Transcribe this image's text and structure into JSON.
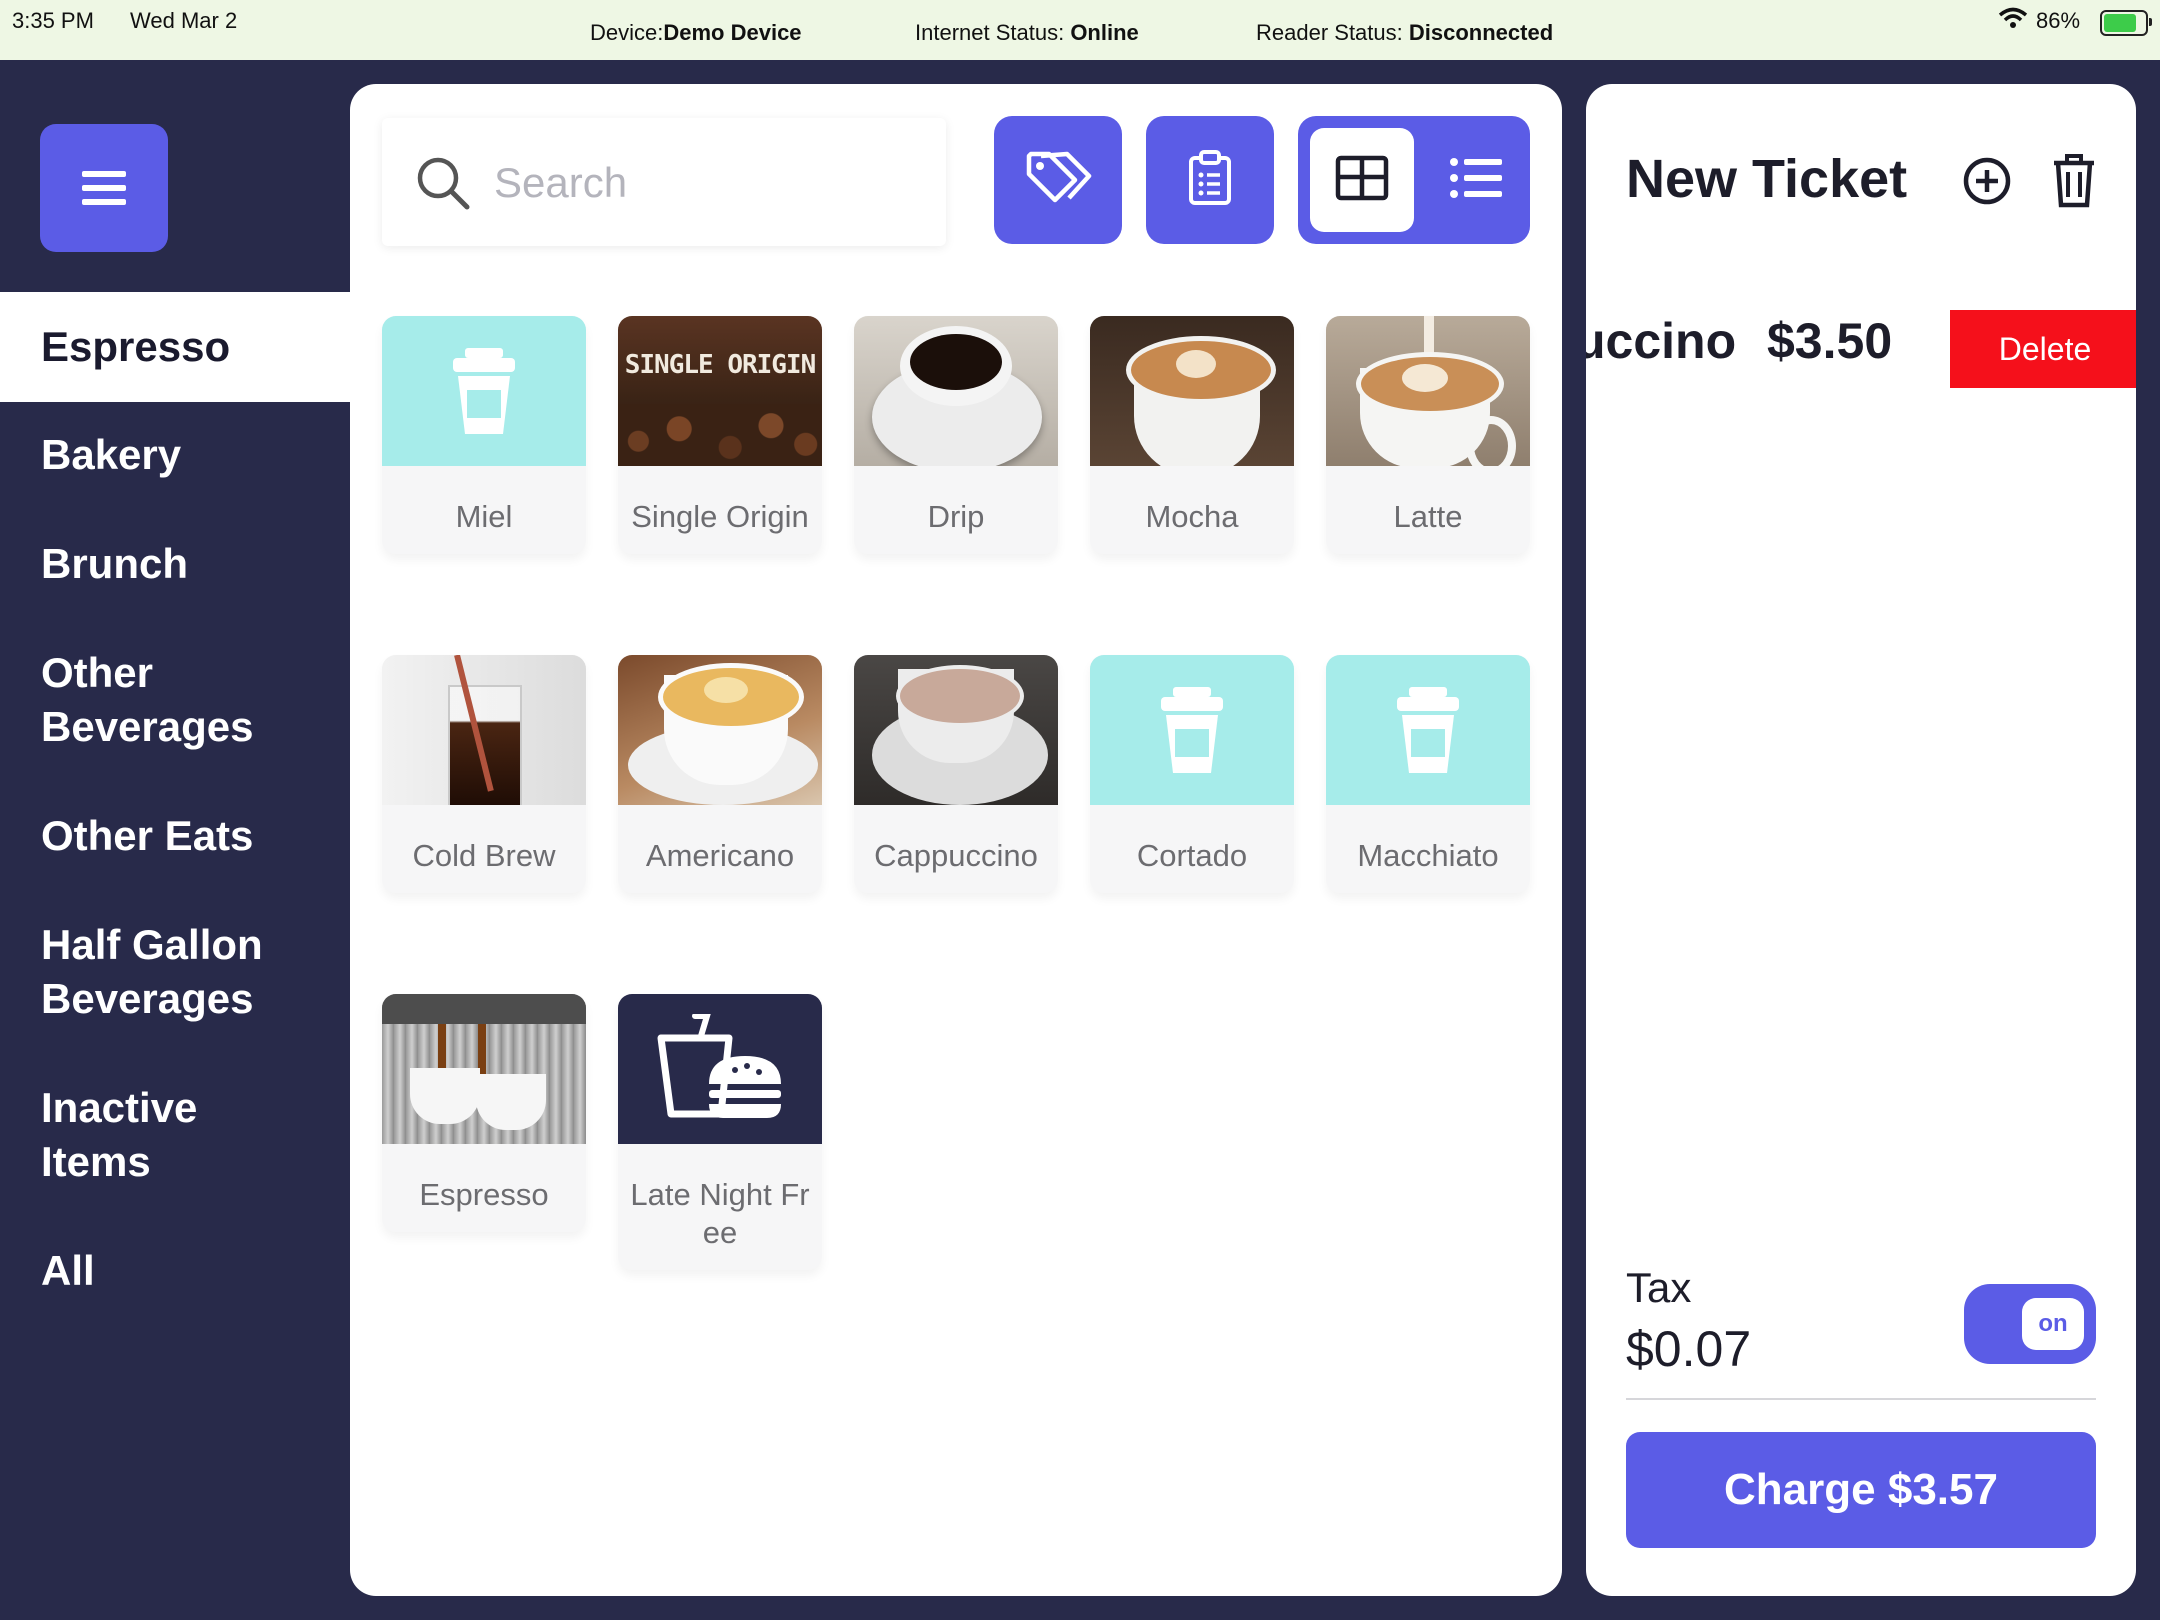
{
  "status_bar": {
    "time": "3:35 PM",
    "date": "Wed Mar 2",
    "device_label": "Device:",
    "device_value": "Demo Device",
    "internet_label": "Internet Status: ",
    "internet_value": "Online",
    "reader_label": "Reader Status: ",
    "reader_value": "Disconnected",
    "battery": "86%"
  },
  "sidebar": {
    "menu_icon": "hamburger-icon",
    "categories": [
      {
        "label": "Espresso",
        "active": true
      },
      {
        "label": "Bakery"
      },
      {
        "label": "Brunch"
      },
      {
        "label": "Other Beverages"
      },
      {
        "label": "Other Eats"
      },
      {
        "label": "Half Gallon Beverages"
      },
      {
        "label": "Inactive Items"
      },
      {
        "label": "All"
      }
    ]
  },
  "search": {
    "placeholder": "Search",
    "value": ""
  },
  "toolbar": {
    "icons": [
      "tag-icon",
      "clipboard-icon",
      "grid-view-icon",
      "list-view-icon"
    ],
    "view_mode": "grid"
  },
  "products": [
    {
      "label": "Miel",
      "image": "cup-icon"
    },
    {
      "label": "Single Origin",
      "image": "photo",
      "banner_text": "SINGLE ORIGIN"
    },
    {
      "label": "Drip",
      "image": "photo"
    },
    {
      "label": "Mocha",
      "image": "photo"
    },
    {
      "label": "Latte",
      "image": "photo"
    },
    {
      "label": "Cold Brew",
      "image": "photo"
    },
    {
      "label": "Americano",
      "image": "photo"
    },
    {
      "label": "Cappuccino",
      "image": "photo"
    },
    {
      "label": "Cortado",
      "image": "cup-icon"
    },
    {
      "label": "Macchiato",
      "image": "cup-icon"
    },
    {
      "label": "Espresso",
      "image": "photo"
    },
    {
      "label": "Late Night Free",
      "image": "drink-burger-icon"
    }
  ],
  "ticket": {
    "title": "New Ticket",
    "line_items": [
      {
        "name": "Cappuccino",
        "visible_name": "ccino",
        "price": "$3.50"
      }
    ],
    "delete_label": "Delete",
    "tax_label": "Tax",
    "tax_amount": "$0.07",
    "tax_toggle": "on",
    "charge_label": "Charge $3.57"
  },
  "colors": {
    "accent": "#5b5ce6",
    "sidebar_bg": "#282a4a",
    "placeholder_tile": "#a6ecea",
    "delete": "#f5101b",
    "status_bar_bg": "#eef7e4"
  }
}
